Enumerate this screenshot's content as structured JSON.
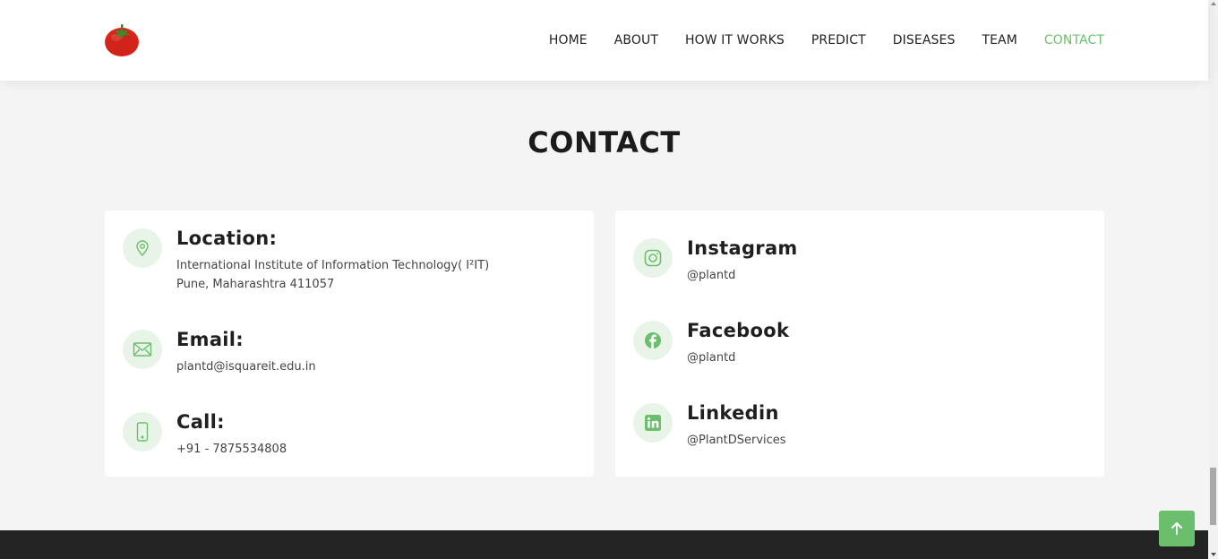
{
  "header": {
    "logo_icon": "tomato-icon",
    "nav": [
      {
        "label": "HOME"
      },
      {
        "label": "ABOUT"
      },
      {
        "label": "HOW IT WORKS"
      },
      {
        "label": "PREDICT"
      },
      {
        "label": "DISEASES"
      },
      {
        "label": "TEAM"
      },
      {
        "label": "CONTACT"
      }
    ],
    "active_nav": "CONTACT"
  },
  "section": {
    "title": "CONTACT"
  },
  "contact_info": {
    "location": {
      "icon": "map-pin-icon",
      "title": "Location:",
      "line1": "International Institute of Information Technology( I²IT)",
      "line2": "Pune, Maharashtra 411057"
    },
    "email": {
      "icon": "envelope-icon",
      "title": "Email:",
      "value": "plantd@isquareit.edu.in"
    },
    "call": {
      "icon": "phone-icon",
      "title": "Call:",
      "value": "+91 - 7875534808"
    }
  },
  "social": {
    "instagram": {
      "icon": "instagram-icon",
      "title": "Instagram",
      "handle": "@plantd"
    },
    "facebook": {
      "icon": "facebook-icon",
      "title": "Facebook",
      "handle": "@plantd"
    },
    "linkedin": {
      "icon": "linkedin-icon",
      "title": "Linkedin",
      "handle": "@PlantDServices"
    }
  },
  "colors": {
    "accent": "#6bbf6c",
    "icon_bg": "#e8f4e8",
    "footer": "#242424",
    "page_bg": "#f4f4f4"
  },
  "back_to_top_icon": "arrow-up-icon"
}
